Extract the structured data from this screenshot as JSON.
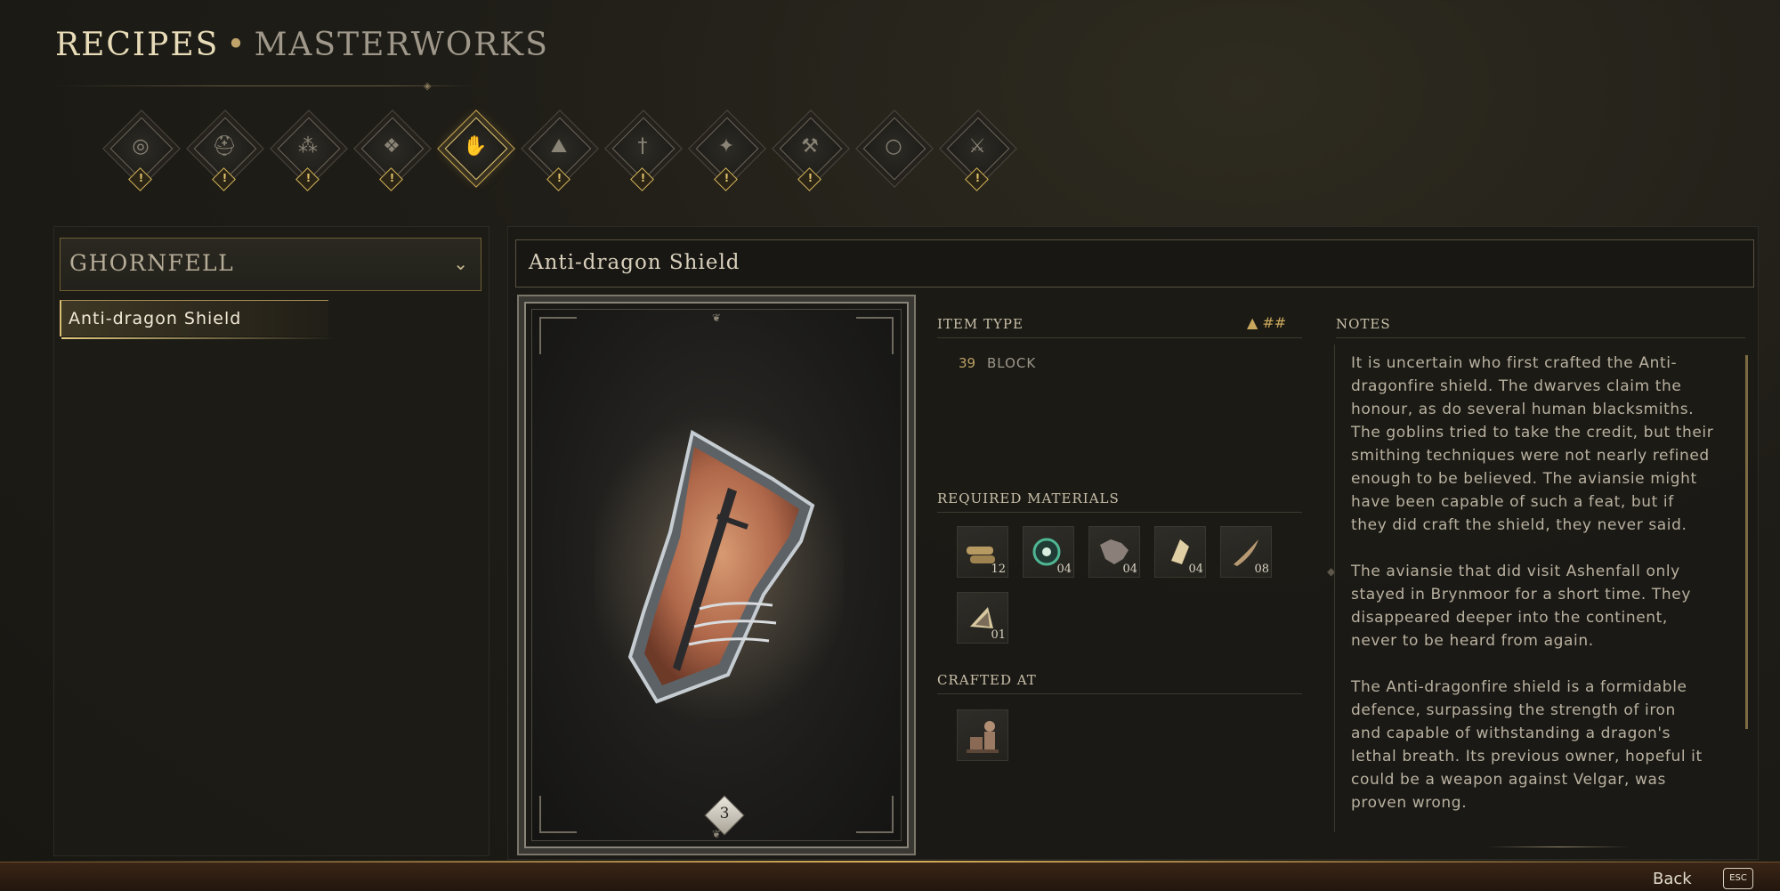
{
  "header": {
    "title_primary": "RECIPES",
    "separator": "•",
    "title_secondary": "MASTERWORKS"
  },
  "categories": [
    {
      "icon": "ring-spiral-icon",
      "glyph": "◎",
      "alert": "!",
      "active": false
    },
    {
      "icon": "helmet-icon",
      "glyph": "⛑",
      "alert": "!",
      "active": false
    },
    {
      "icon": "ore-pile-icon",
      "glyph": "⁂",
      "alert": "!",
      "active": false
    },
    {
      "icon": "cluster-icon",
      "glyph": "❖",
      "alert": "!",
      "active": false
    },
    {
      "icon": "gauntlet-icon",
      "glyph": "✋",
      "alert": "",
      "active": true
    },
    {
      "icon": "treasure-pile-icon",
      "glyph": "⛰",
      "alert": "!",
      "active": false
    },
    {
      "icon": "sword-icon",
      "glyph": "†",
      "alert": "!",
      "active": false
    },
    {
      "icon": "sparkle-icon",
      "glyph": "✦",
      "alert": "!",
      "active": false
    },
    {
      "icon": "pickaxe-icon",
      "glyph": "⚒",
      "alert": "!",
      "active": false
    },
    {
      "icon": "ring-icon",
      "glyph": "○",
      "alert": "",
      "active": false
    },
    {
      "icon": "axe-icon",
      "glyph": "⚔",
      "alert": "!",
      "active": false
    }
  ],
  "left_panel": {
    "region": "GHORNFELL",
    "region_chevron": "⌄",
    "recipes": [
      "Anti-dragon Shield"
    ]
  },
  "item": {
    "title": "Anti-dragon Shield",
    "tier": "3",
    "item_type_label": "ITEM TYPE",
    "type_icons": "▲ ##",
    "stat_value": "39",
    "stat_name": "BLOCK",
    "required_materials_label": "REQUIRED MATERIALS",
    "materials": [
      {
        "icon": "bark-bundle-icon",
        "count": "12"
      },
      {
        "icon": "green-essence-icon",
        "count": "04"
      },
      {
        "icon": "hide-icon",
        "count": "04"
      },
      {
        "icon": "bone-shard-icon",
        "count": "04"
      },
      {
        "icon": "feather-icon",
        "count": "08"
      },
      {
        "icon": "crystal-shard-icon",
        "count": "01"
      }
    ],
    "crafted_at_label": "CRAFTED AT",
    "crafting_station_icon": "forge-station-icon",
    "notes_label": "NOTES",
    "notes": "It is uncertain who first crafted the Anti-\ndragonfire shield. The dwarves claim the\nhonour, as do several human blacksmiths.\nThe goblins tried to take the credit, but their\nsmithing techniques were not nearly refined\nenough to be believed. The aviansie might\nhave been capable of such a feat, but if\nthey did craft the shield, they never said.\n\nThe aviansie that did visit Ashenfall only\nstayed in Brynmoor for a short time. They\ndisappeared deeper into the continent,\nnever to be heard from again.\n\nThe Anti-dragonfire shield is a formidable\ndefence, surpassing the strength of iron\nand capable of withstanding a dragon's\nlethal breath. Its previous owner, hopeful it\ncould be a weapon against Velgar, was\nproven wrong."
  },
  "footer": {
    "back_label": "Back",
    "back_key": "ESC"
  },
  "colors": {
    "accent_gold": "#d8b05c",
    "background": "#1f1d17",
    "text": "#cfc7b2"
  }
}
